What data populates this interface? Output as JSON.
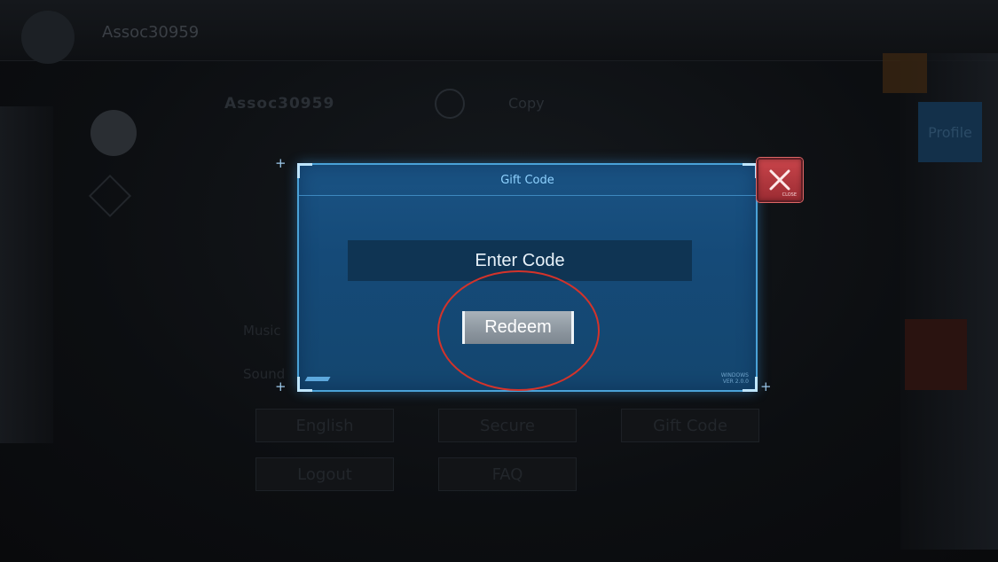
{
  "background": {
    "player_name_top": "Assoc30959",
    "player_name_main": "Assoc30959",
    "copy_label": "Copy",
    "profile_label": "Profile",
    "rows": [
      "Music",
      "Sound"
    ],
    "buttons": [
      "English",
      "Secure",
      "Gift Code",
      "Logout",
      "FAQ"
    ]
  },
  "modal": {
    "title": "Gift Code",
    "input_placeholder": "Enter Code",
    "redeem_label": "Redeem",
    "close_label": "CLOSE",
    "version_line1": "WINDOWS",
    "version_line2": "VER 2.0.0"
  },
  "colors": {
    "modal_bg": "#154a78",
    "modal_border": "#4aa2d8",
    "close_bg": "#c8444a",
    "highlight": "#d4332a"
  }
}
